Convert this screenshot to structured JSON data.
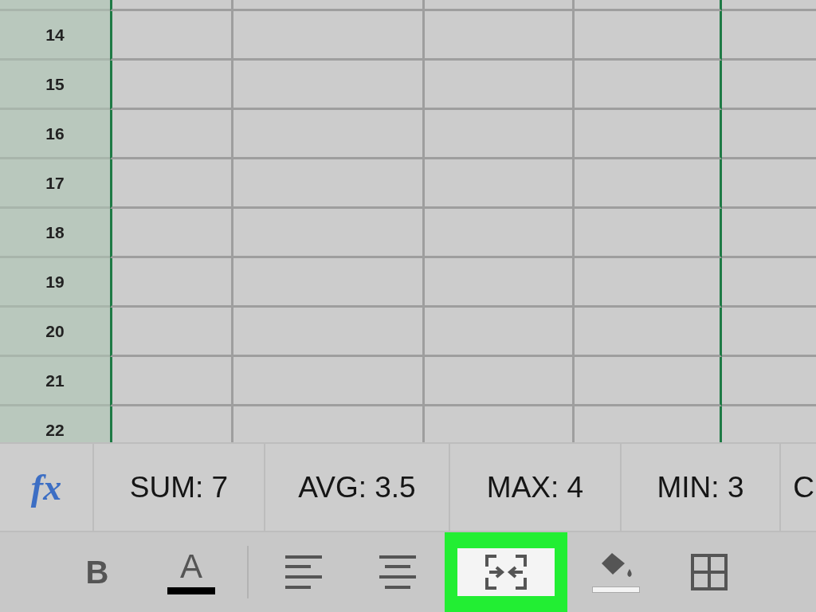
{
  "sheet": {
    "selection": {
      "visible": true
    },
    "rows": [
      {
        "label": ""
      },
      {
        "label": "14"
      },
      {
        "label": "15"
      },
      {
        "label": "16"
      },
      {
        "label": "17"
      },
      {
        "label": "18"
      },
      {
        "label": "19"
      },
      {
        "label": "20"
      },
      {
        "label": "21"
      },
      {
        "label": "22"
      }
    ]
  },
  "summary_bar": {
    "function_label": "fx",
    "stats": [
      "SUM: 7",
      "AVG: 3.5",
      "MAX: 4",
      "MIN: 3",
      "C"
    ]
  },
  "toolbar": [
    {
      "kind": "bold",
      "label": "B",
      "highlighted": false
    },
    {
      "kind": "text-color",
      "label": "A",
      "color": "#000000",
      "highlighted": false
    },
    {
      "kind": "divider"
    },
    {
      "kind": "align-left",
      "highlighted": false
    },
    {
      "kind": "align-center",
      "highlighted": false
    },
    {
      "kind": "merge",
      "highlighted": true
    },
    {
      "kind": "fill-color",
      "color": "#f4f4f4",
      "highlighted": false
    },
    {
      "kind": "borders",
      "highlighted": false
    }
  ]
}
